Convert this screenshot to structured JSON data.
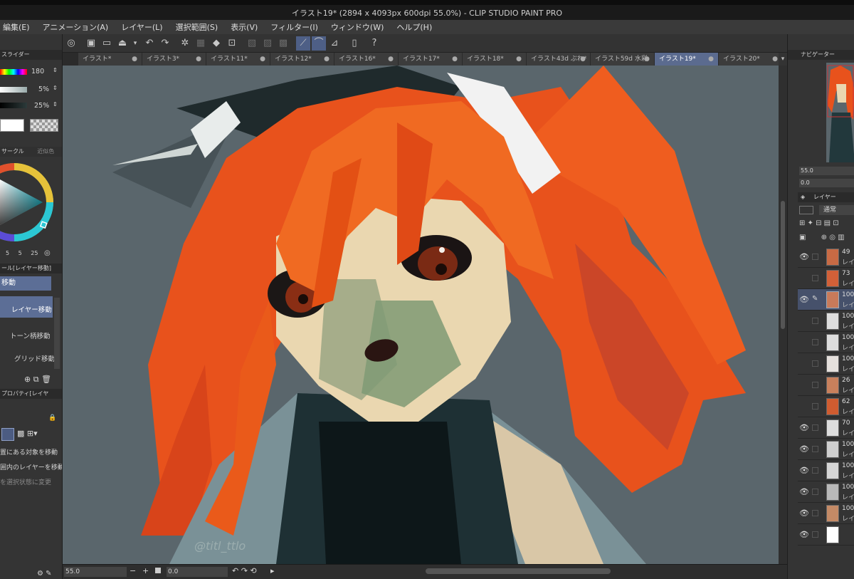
{
  "window": {
    "title": "イラスト19* (2894 x 4093px 600dpi 55.0%) - CLIP STUDIO PAINT PRO"
  },
  "menu": [
    "編集(E)",
    "アニメーション(A)",
    "レイヤー(L)",
    "選択範囲(S)",
    "表示(V)",
    "フィルター(I)",
    "ウィンドウ(W)",
    "ヘルプ(H)"
  ],
  "tabs": [
    {
      "label": "イラスト*",
      "active": false
    },
    {
      "label": "イラスト3*",
      "active": false
    },
    {
      "label": "イラスト11*",
      "active": false
    },
    {
      "label": "イラスト12*",
      "active": false
    },
    {
      "label": "イラスト16*",
      "active": false
    },
    {
      "label": "イラスト17*",
      "active": false
    },
    {
      "label": "イラスト18*",
      "active": false
    },
    {
      "label": "イラスト43d ぶれ*",
      "active": false
    },
    {
      "label": "イラスト59d 水彩",
      "active": false
    },
    {
      "label": "イラスト19*",
      "active": true
    },
    {
      "label": "イラスト20*",
      "active": false
    }
  ],
  "left_panel": {
    "slider_header": "スライダー",
    "hue_value": "180",
    "sat_value": "5%",
    "val_value": "25%",
    "color_circle_tab": "サークル",
    "approx_tab": "近似色",
    "color_nums": [
      "5",
      "5",
      "25"
    ],
    "tool_header": "ール[レイヤー移動]",
    "tool_selected": "移動",
    "subtools": [
      "レイヤー移動",
      "トーン柄移動",
      "グリッド移動"
    ],
    "prop_header": "プロパティ[レイヤ",
    "prop_lines": [
      "置にある対象を移動",
      "囲内のレイヤーを移動",
      "を選択状態に変更"
    ]
  },
  "right_panel": {
    "navigator_tab": "ナビゲーター",
    "zoom_value": "55.0",
    "rotate_value": "0.0",
    "layer_tab": "レイヤー",
    "blend_mode": "通常",
    "layers": [
      {
        "opacity": "49",
        "name": "レイ",
        "visible": true,
        "selected": false
      },
      {
        "opacity": "73",
        "name": "レイ",
        "visible": false,
        "selected": false
      },
      {
        "opacity": "100",
        "name": "レイ",
        "visible": true,
        "selected": true
      },
      {
        "opacity": "100",
        "name": "レイ",
        "visible": false,
        "selected": false
      },
      {
        "opacity": "100",
        "name": "レイ",
        "visible": false,
        "selected": false
      },
      {
        "opacity": "100",
        "name": "レイ",
        "visible": false,
        "selected": false
      },
      {
        "opacity": "26",
        "name": "レイ",
        "visible": false,
        "selected": false
      },
      {
        "opacity": "62",
        "name": "レイ",
        "visible": false,
        "selected": false
      },
      {
        "opacity": "70",
        "name": "レイ",
        "visible": true,
        "selected": false
      },
      {
        "opacity": "100",
        "name": "レイ",
        "visible": true,
        "selected": false
      },
      {
        "opacity": "100",
        "name": "レイ",
        "visible": true,
        "selected": false
      },
      {
        "opacity": "100",
        "name": "レイ",
        "visible": true,
        "selected": false
      },
      {
        "opacity": "100",
        "name": "レイ",
        "visible": true,
        "selected": false
      },
      {
        "opacity": "",
        "name": "",
        "visible": true,
        "selected": false
      }
    ]
  },
  "status": {
    "zoom": "55.0",
    "angle": "0.0"
  },
  "canvas": {
    "signature": "@titl_ttlo"
  }
}
